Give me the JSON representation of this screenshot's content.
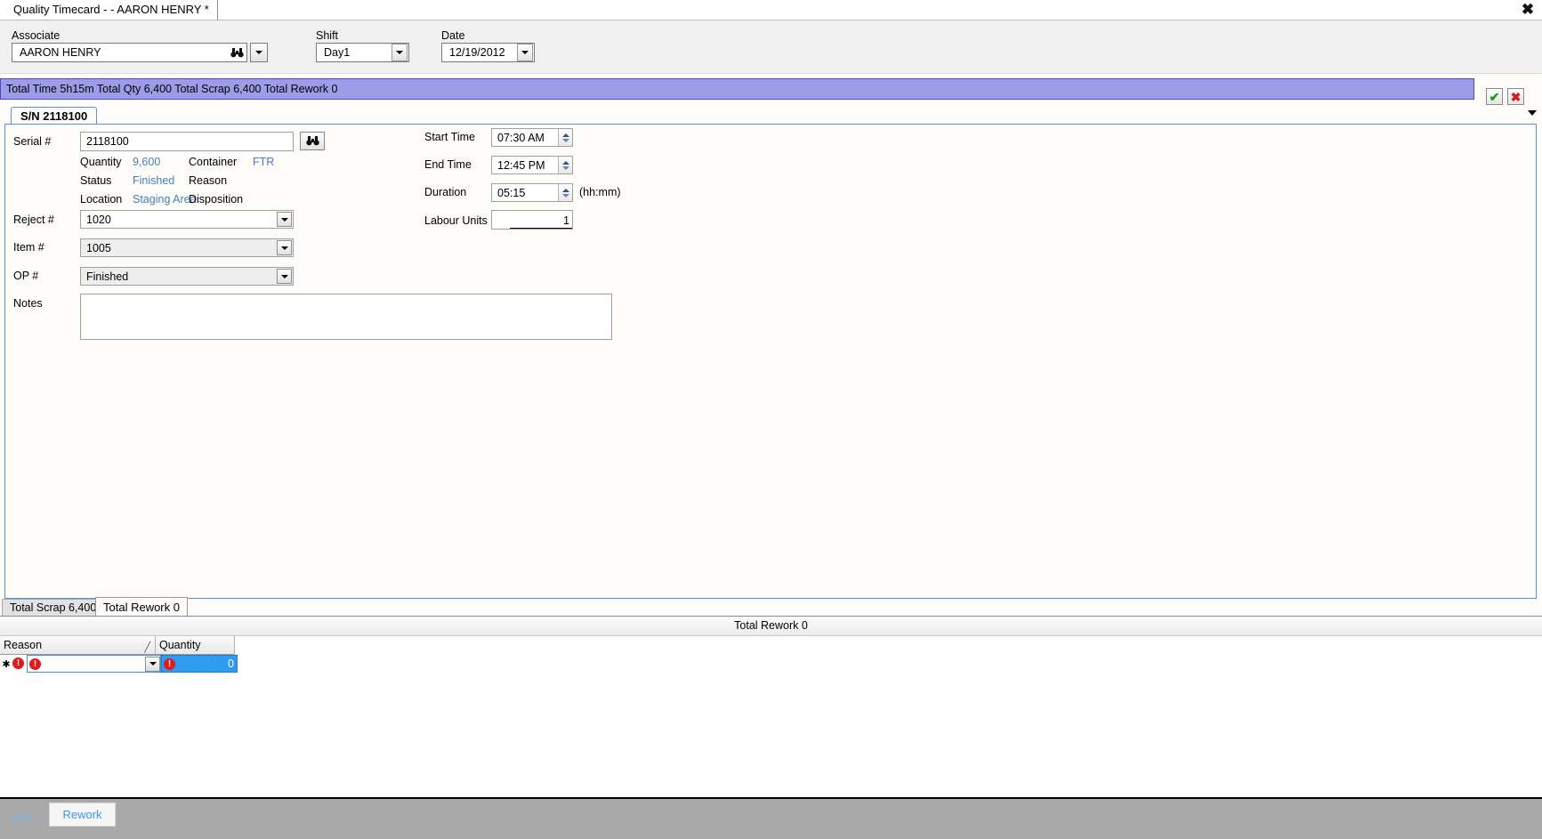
{
  "window": {
    "tab_title": "Quality Timecard - - AARON HENRY *",
    "close_label": "✖"
  },
  "header": {
    "associate_label": "Associate",
    "associate_value": "AARON HENRY",
    "shift_label": "Shift",
    "shift_value": "Day1",
    "date_label": "Date",
    "date_value": "12/19/2012"
  },
  "summary": {
    "text": "Total Time 5h15m  Total Qty 6,400  Total Scrap 6,400 Total Rework 0",
    "accept_glyph": "✔",
    "reject_glyph": "✖",
    "bar_color": "#9c9ce8"
  },
  "sn_tab": {
    "label": "S/N 2118100"
  },
  "form": {
    "serial_label": "Serial #",
    "serial_value": "2118100",
    "search_glyph": "🔭",
    "quantity_label": "Quantity",
    "quantity_value": "9,600",
    "container_label": "Container",
    "container_value": "FTR",
    "status_label": "Status",
    "status_value": "Finished",
    "reason_label": "Reason",
    "reason_value": "",
    "location_label": "Location",
    "location_value": "Staging Area",
    "disposition_label": "Disposition",
    "disposition_value": "",
    "reject_label": "Reject #",
    "reject_value": "1020",
    "item_label": "Item #",
    "item_value": "1005",
    "op_label": "OP #",
    "op_value": "Finished",
    "notes_label": "Notes",
    "notes_value": "",
    "start_time_label": "Start Time",
    "start_time_value": "07:30 AM",
    "end_time_label": "End Time",
    "end_time_value": "12:45 PM",
    "duration_label": "Duration",
    "duration_value": "05:15",
    "duration_hint": "(hh:mm)",
    "labour_label": "Labour Units",
    "labour_value": "1",
    "link_color": "#4a7ebb"
  },
  "bottom_tabs": [
    {
      "label": "Total Scrap 6,400",
      "active": false
    },
    {
      "label": "Total Rework 0",
      "active": true
    }
  ],
  "grid": {
    "title": "Total Rework 0",
    "columns": [
      {
        "label": "Reason",
        "sort_mark": "╱"
      },
      {
        "label": "Quantity",
        "sort_mark": ""
      }
    ],
    "rows": [
      {
        "marker": "✱",
        "reason": "",
        "quantity": "0",
        "reason_error": true,
        "quantity_error": true
      }
    ],
    "error_glyph": "!",
    "error_color": "#e01b1b",
    "selection_color": "#2e9bf0"
  },
  "footer": {
    "add_label": "Add ...",
    "rework_label": "Rework",
    "link_color": "#7fb3e8"
  }
}
